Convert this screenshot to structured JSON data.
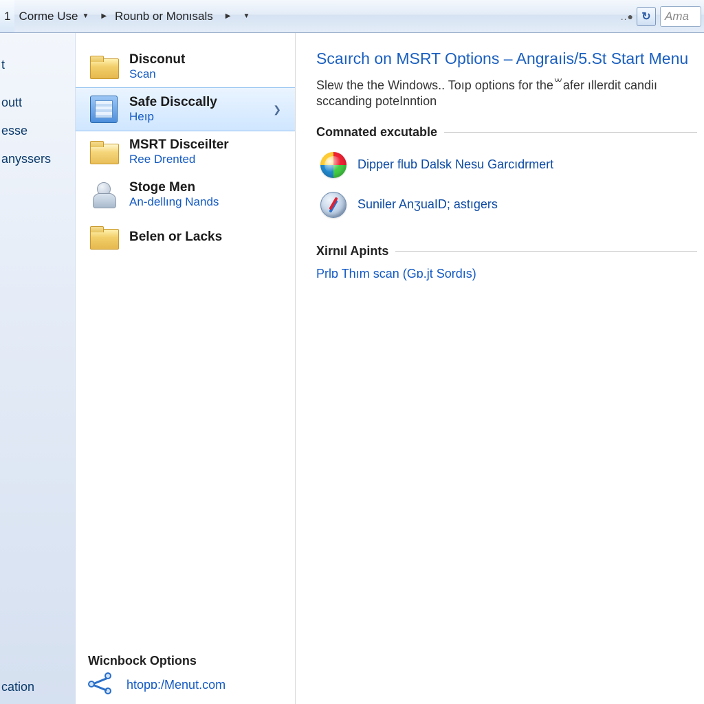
{
  "addressbar": {
    "crumb0": "1",
    "crumb1": "Corme Use",
    "crumb2": "Rounb or Monısals",
    "search_placeholder": "Ama",
    "dots": "..●"
  },
  "leftrail": {
    "items": [
      "t",
      "outt",
      "esse",
      "anyssers"
    ],
    "bottom": "cation"
  },
  "tasks": {
    "items": [
      {
        "title": "Disconut",
        "sub": "Scan"
      },
      {
        "title": "Safe Disccally",
        "sub": "Heıp"
      },
      {
        "title": "MSRT Disceilter",
        "sub": "Ree Drented"
      },
      {
        "title": "Stoge Men",
        "sub": "An-dellıng Nands"
      },
      {
        "title": "Belen or Lacks",
        "sub": ""
      }
    ],
    "seealso_heading": "Wicnbock Options",
    "seealso_link": "htopɒ:/Menut.com"
  },
  "content": {
    "heading": "Scaırch on MSRT Options – Angraıis/5.St Start Menu",
    "desc": "Slew the the Windows..  Toıp options for the꒳afer ıllerdit candiı sccanding poteInntion",
    "section1": {
      "heading": "Comnated excutable",
      "links": [
        "Dipper flub Dalsk Nesu Garcıdrmert",
        "Suniler AnʒuaID; astıgers"
      ]
    },
    "section2": {
      "heading": "Xirnıl Apints",
      "link": "Prlɒ Thım scan (Gɒ.jt Sordıs)"
    }
  }
}
